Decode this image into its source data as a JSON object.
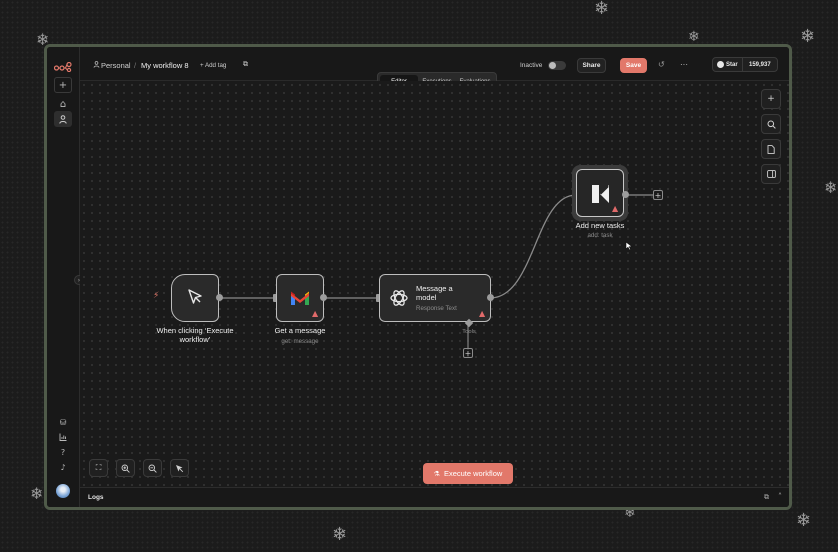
{
  "breadcrumb": {
    "project_icon": "user-icon",
    "project": "Personal",
    "separator": "/",
    "workflow_name": "My workflow 8",
    "add_tag": "+ Add tag"
  },
  "topbar": {
    "status_label": "Inactive",
    "share_label": "Share",
    "save_label": "Save",
    "github_star_label": "Star",
    "github_star_count": "159,937",
    "more_label": "···"
  },
  "tabs": [
    "Editor",
    "Executions",
    "Evaluations"
  ],
  "nodes": {
    "trigger": {
      "label": "When clicking ‘Execute workflow’",
      "icon": "cursor-pointer-icon"
    },
    "gmail": {
      "label": "Get a message",
      "sub": "get: message",
      "icon": "gmail-icon"
    },
    "openai": {
      "label": "Message a model",
      "sub": "Response Text",
      "icon": "openai-icon",
      "tools_label": "Tools"
    },
    "tasks": {
      "label": "Add new tasks",
      "sub": "add: task",
      "icon": "k-logo-icon"
    }
  },
  "canvas": {
    "execute_label": "Execute workflow"
  },
  "logs": {
    "label": "Logs"
  },
  "colors": {
    "accent": "#e2786a",
    "frame": "#4f5a49",
    "warning": "#e06a6a"
  }
}
